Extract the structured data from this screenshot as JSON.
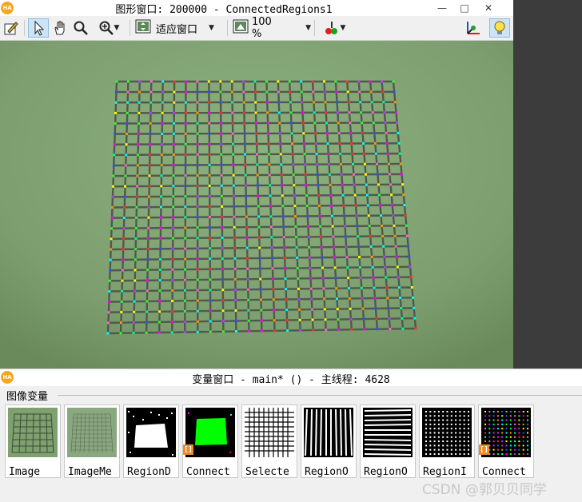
{
  "graphics_window": {
    "app_badge": "HA",
    "title": "图形窗口: 200000 - ConnectedRegions1",
    "controls": {
      "minimize": "—",
      "maximize": "□",
      "close": "✕"
    }
  },
  "toolbar": {
    "fit_label": "适应窗口",
    "zoom_label": "100 %",
    "icons": [
      "draw-icon",
      "pointer-icon",
      "hand-icon",
      "magnifier-icon",
      "zoom-in-icon",
      "fit-window-icon",
      "zoom-percent-icon",
      "color-palette-icon",
      "axis-icon",
      "lightbulb-icon"
    ]
  },
  "variable_window": {
    "app_badge": "HA",
    "title": "变量窗口 - main* () - 主线程: 4628",
    "section_label": "图像变量",
    "items": [
      {
        "name": "Image",
        "has_badge": false
      },
      {
        "name": "ImageMe",
        "has_badge": false
      },
      {
        "name": "RegionD",
        "has_badge": false
      },
      {
        "name": "Connect",
        "has_badge": true
      },
      {
        "name": "Selecte",
        "has_badge": false
      },
      {
        "name": "RegionO",
        "has_badge": false
      },
      {
        "name": "RegionO",
        "has_badge": false
      },
      {
        "name": "RegionI",
        "has_badge": false
      },
      {
        "name": "Connect",
        "has_badge": true
      }
    ],
    "badge_symbol": "[]"
  },
  "watermark": "CSDN @郭贝贝同学",
  "colors": {
    "viewport_bg": "#7e9f70",
    "grid_line": "#4f5a4c",
    "badge_orange": "#f08a24",
    "region_green": "#00ff00"
  }
}
